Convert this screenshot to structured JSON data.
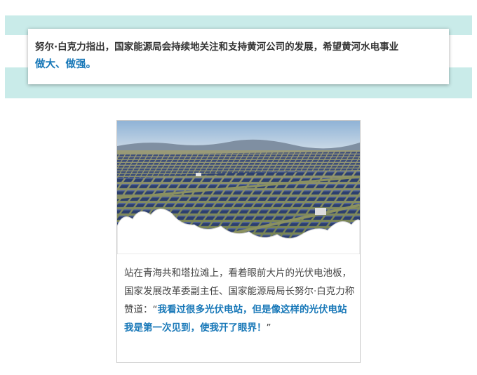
{
  "quote": {
    "line1": "努尔·白克力指出，国家能源局会持续地关注和支持黄河公司的发展，希望黄河水电事业",
    "line2": "做大、做强。"
  },
  "story": {
    "caption_plain_1": "站在青海共和塔拉滩上，看着眼前大片的光伏电池板，国家发展改革委副主任、国家能源局局长努尔·白克力称赞道：",
    "caption_quote_open": "“",
    "caption_highlight": "我看过很多光伏电站，但是像这样的光伏电站我是第一次见到，使我开了眼界！",
    "caption_quote_close": "”"
  },
  "colors": {
    "band": "#c9ebe9",
    "accent": "#1878b8",
    "text": "#333333"
  }
}
